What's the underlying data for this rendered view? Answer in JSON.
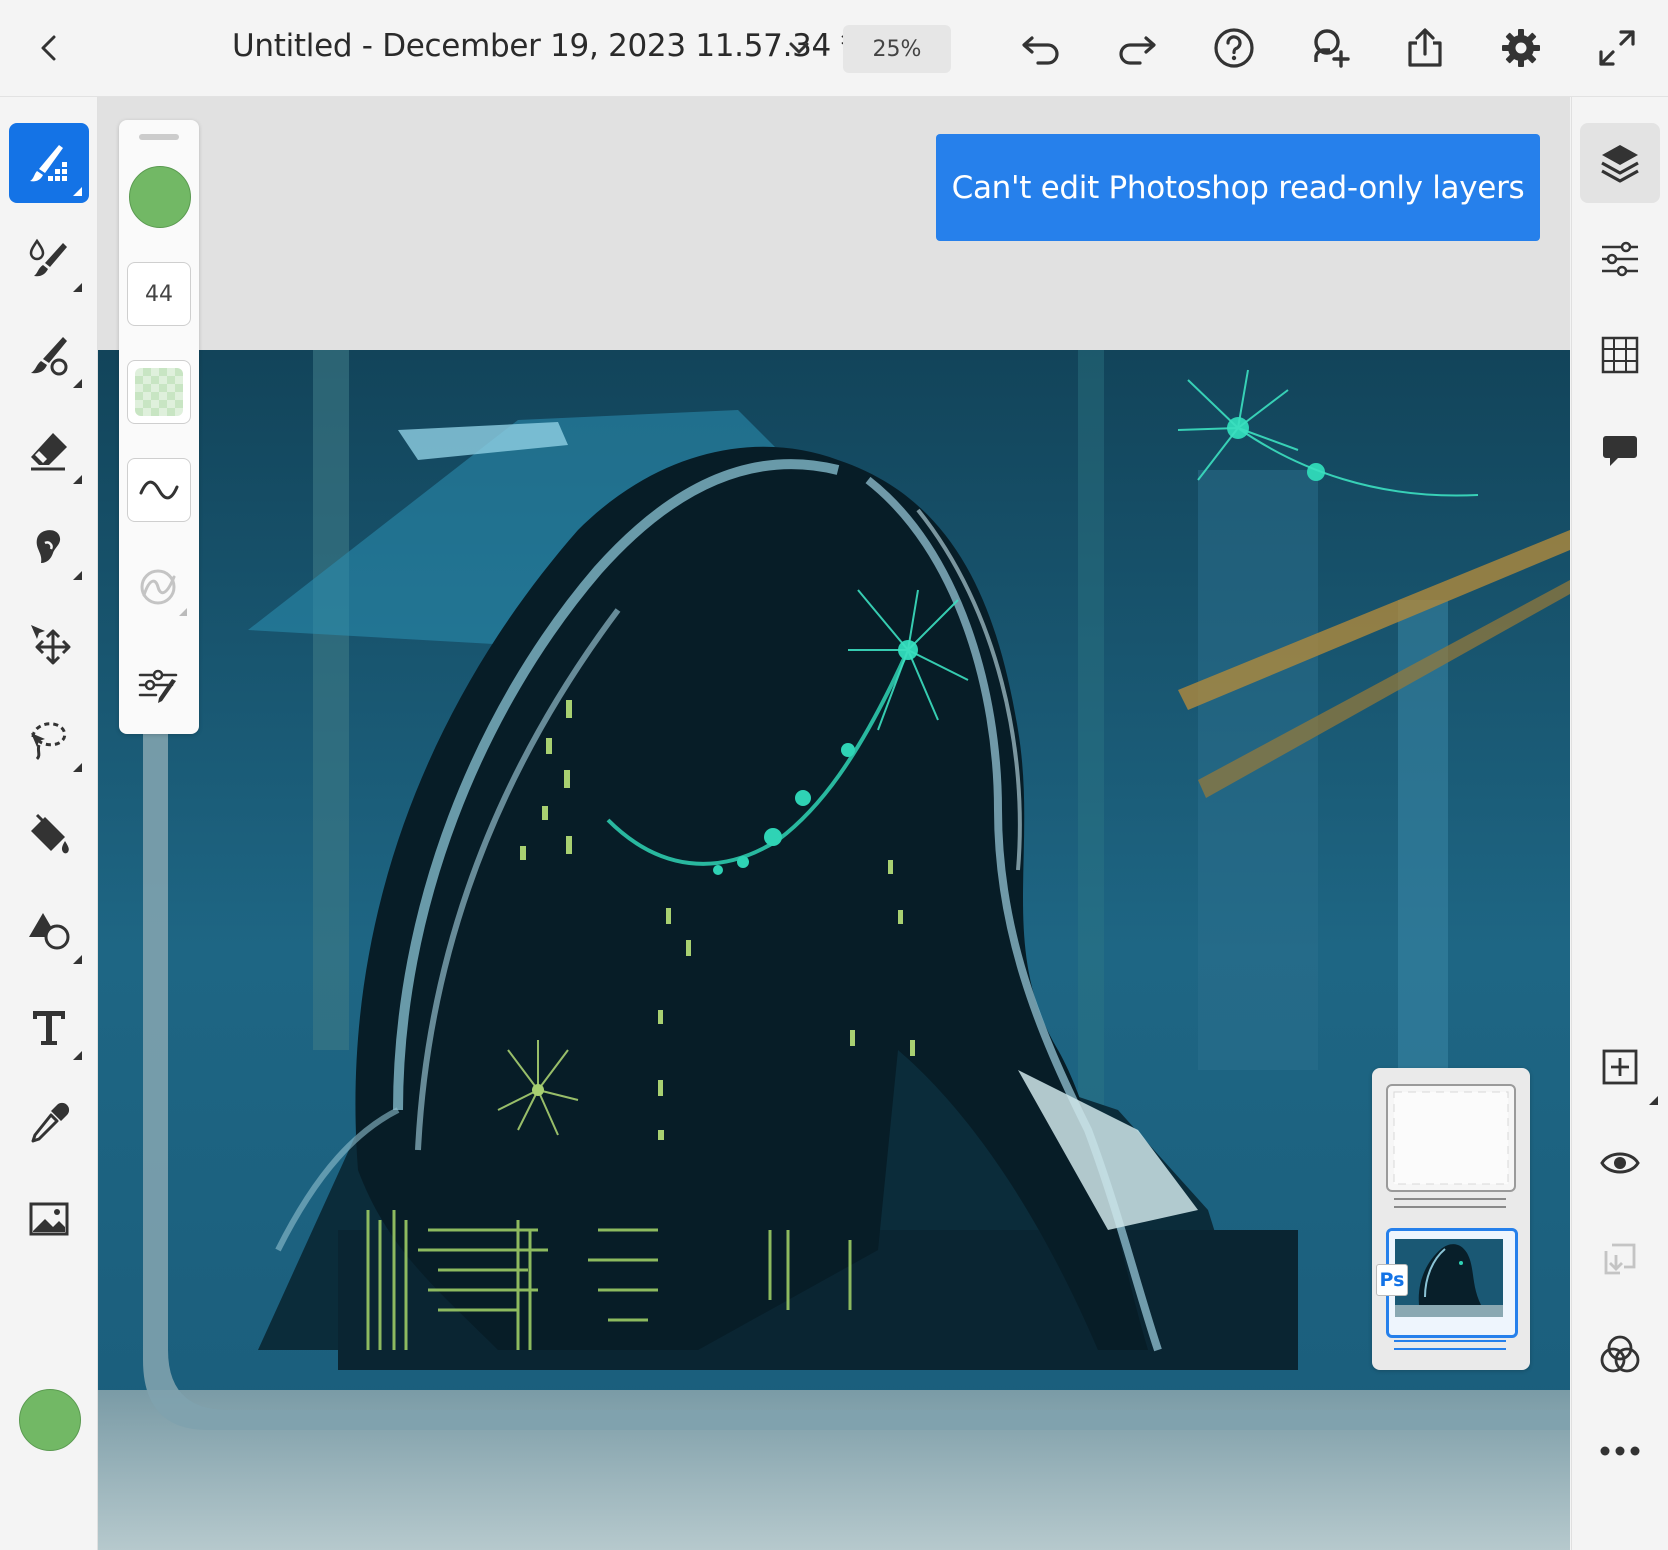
{
  "header": {
    "back_icon": "chevron-left-icon",
    "title": "Untitled - December 19, 2023 11.57.34 *",
    "title_dropdown_icon": "chevron-down-icon",
    "zoom": "25%",
    "actions": [
      "undo-icon",
      "redo-icon",
      "help-icon",
      "invite-user-icon",
      "share-icon",
      "settings-icon",
      "fullscreen-icon"
    ]
  },
  "left_tools": [
    "pixel-brush-icon",
    "live-brush-icon",
    "brush-icon",
    "eraser-icon",
    "smudge-icon",
    "transform-icon",
    "lasso-icon",
    "fill-icon",
    "shapes-icon",
    "text-icon",
    "eyedropper-icon",
    "image-icon"
  ],
  "left_color": "#72b865",
  "brush_panel": {
    "color": "#72b865",
    "size": "44",
    "opacity_icon": "opacity-checker-icon",
    "flow_icon": "flow-wave-icon",
    "pressure_icon": "pressure-icon",
    "settings_icon": "brush-settings-icon"
  },
  "toast": {
    "message": "Can't edit Photoshop read-only layers",
    "color": "#2680eb"
  },
  "right_tools": [
    "layers-icon",
    "layer-properties-icon",
    "grid-icon",
    "comment-icon",
    "add-layer-icon",
    "visibility-icon",
    "merge-down-icon",
    "blend-modes-icon",
    "more-icon"
  ],
  "layers_panel": {
    "badge": "Ps"
  }
}
